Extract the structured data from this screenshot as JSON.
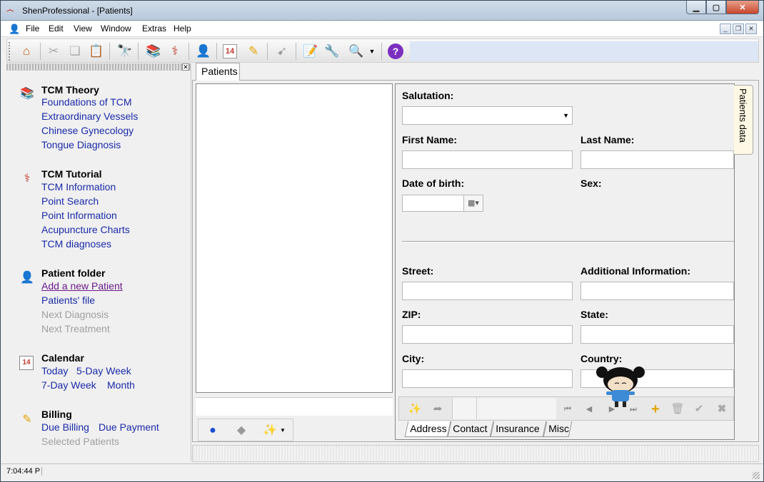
{
  "window": {
    "title": "ShenProfessional - [Patients]"
  },
  "menu": [
    "File",
    "Edit",
    "View",
    "Window",
    "Extras",
    "Help"
  ],
  "toolbar": {
    "icons": [
      "home-icon",
      "cut-icon",
      "copy-icon",
      "paste-icon",
      "binoculars-icon",
      "books-icon",
      "acupuncture-icon",
      "patient-icon",
      "calendar-icon",
      "billing-icon",
      "export-icon",
      "edit-icon",
      "wrench-icon",
      "preview-icon",
      "dropdown-arrow-icon",
      "help-icon"
    ],
    "calendar_day": "14",
    "help_glyph": "?"
  },
  "sidebar": {
    "sections": [
      {
        "title": "TCM Theory",
        "icon": "books-icon",
        "links": [
          {
            "label": "Foundations of TCM"
          },
          {
            "label": "Extraordinary Vessels"
          },
          {
            "label": "Chinese Gynecology"
          },
          {
            "label": "Tongue Diagnosis"
          }
        ]
      },
      {
        "title": "TCM Tutorial",
        "icon": "acupuncture-icon",
        "links": [
          {
            "label": "TCM Information"
          },
          {
            "label": "Point Search"
          },
          {
            "label": "Point Information"
          },
          {
            "label": "Acupuncture Charts"
          },
          {
            "label": "TCM diagnoses"
          }
        ]
      },
      {
        "title": "Patient folder",
        "icon": "patient-icon",
        "links": [
          {
            "label": "Add a new Patient",
            "state": "visited"
          },
          {
            "label": "Patients' file"
          },
          {
            "label": "Next Diagnosis",
            "state": "disabled"
          },
          {
            "label": "Next Treatment",
            "state": "disabled"
          }
        ]
      },
      {
        "title": "Calendar",
        "icon": "calendar-icon",
        "links": [
          {
            "label": "Today"
          },
          {
            "label": "5-Day Week"
          },
          {
            "label": "7-Day Week"
          },
          {
            "label": "Month"
          }
        ]
      },
      {
        "title": "Billing",
        "icon": "billing-icon",
        "links": [
          {
            "label": "Due Billing"
          },
          {
            "label": "Due Payment"
          },
          {
            "label": "Selected Patients",
            "state": "disabled"
          }
        ]
      }
    ]
  },
  "tabs": {
    "main": "Patients",
    "side": "Patients data"
  },
  "form": {
    "salutation": {
      "label": "Salutation:",
      "value": ""
    },
    "first_name": {
      "label": "First Name:",
      "value": ""
    },
    "last_name": {
      "label": "Last Name:",
      "value": ""
    },
    "dob": {
      "label": "Date of birth:",
      "value": ""
    },
    "sex": {
      "label": "Sex:"
    },
    "street": {
      "label": "Street:",
      "value": ""
    },
    "additional": {
      "label": "Additional Information:",
      "value": ""
    },
    "zip": {
      "label": "ZIP:",
      "value": ""
    },
    "state": {
      "label": "State:",
      "value": ""
    },
    "city": {
      "label": "City:",
      "value": ""
    },
    "country": {
      "label": "Country:",
      "value": ""
    }
  },
  "bottom_tabs": [
    "Address",
    "Contact",
    "Insurance",
    "Misc"
  ],
  "status": {
    "time": "7:04:44 P"
  },
  "colors": {
    "link": "#1a2aa8",
    "visited": "#6a1b8a",
    "disabled": "#a0a0a0",
    "help": "#7b2fbf"
  }
}
